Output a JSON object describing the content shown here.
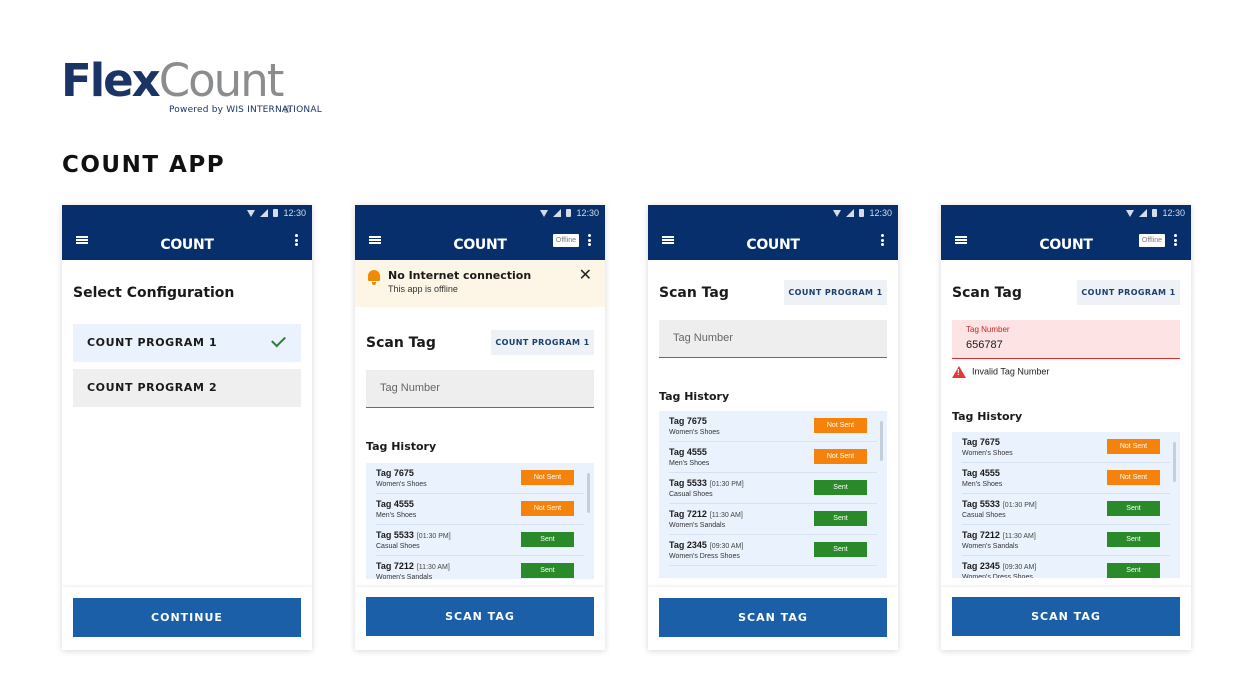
{
  "brand": {
    "flex": "Flex",
    "count": "Count",
    "reg": "®",
    "powered_by": "Powered by WIS INTERNATIONAL"
  },
  "page_title": "COUNT APP",
  "status_time": "12:30",
  "app_title": "COUNT",
  "offline_badge": "Offline",
  "screen1": {
    "heading": "Select Configuration",
    "options": [
      {
        "label": "COUNT PROGRAM 1",
        "selected": true
      },
      {
        "label": "COUNT PROGRAM 2",
        "selected": false
      }
    ],
    "button": "CONTINUE"
  },
  "banner": {
    "title": "No Internet connection",
    "subtitle": "This app is offline",
    "close": "✕"
  },
  "scan": {
    "heading": "Scan Tag",
    "program_chip": "COUNT PROGRAM 1",
    "placeholder": "Tag Number",
    "history_heading": "Tag History",
    "button": "SCAN TAG"
  },
  "error_screen": {
    "label": "Tag Number",
    "value": "656787",
    "error": "Invalid Tag Number"
  },
  "status_labels": {
    "not_sent": "Not Sent",
    "sent": "Sent"
  },
  "history": [
    {
      "tag": "Tag 7675",
      "time": "",
      "desc": "Women's Shoes",
      "status": "Not Sent"
    },
    {
      "tag": "Tag 4555",
      "time": "",
      "desc": "Men's Shoes",
      "status": "Not Sent"
    },
    {
      "tag": "Tag 5533",
      "time": "[01:30 PM]",
      "desc": "Casual Shoes",
      "status": "Sent"
    },
    {
      "tag": "Tag 7212",
      "time": "[11:30 AM]",
      "desc": "Women's Sandals",
      "status": "Sent"
    },
    {
      "tag": "Tag 2345",
      "time": "[09:30 AM]",
      "desc": "Women's Dress Shoes",
      "status": "Sent"
    }
  ]
}
